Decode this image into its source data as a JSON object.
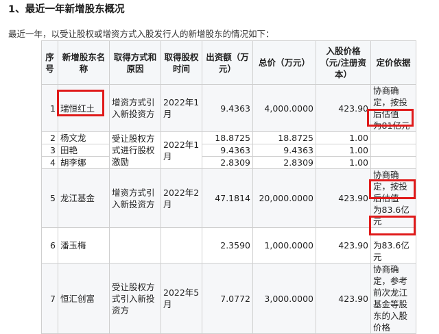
{
  "heading": "1、最近一年新增股东概况",
  "intro": "最近一年，以受让股权或增资方式入股发行人的新增股东的情况如下：",
  "table": {
    "headers": {
      "seq": "序号",
      "name": "新增股东名称",
      "method": "取得方式和原因",
      "time": "取得股权时间",
      "amount": "出资额（万元）",
      "total": "总价（万元）",
      "price": "入股价格（元/注册资本）",
      "basis": "定价依据"
    },
    "rows": [
      {
        "seq": "1",
        "name": "瑞恒红土",
        "method": "增资方式引入新投资方",
        "time": "2022年1月",
        "amount": "9.4363",
        "total": "4,000.0000",
        "price": "423.90",
        "basis_a": "协商确定，按投后估值",
        "basis_b": "为81亿元"
      },
      {
        "seq": "2",
        "name": "杨文龙",
        "amount": "18.8725",
        "total": "18.8725",
        "price": "1.00"
      },
      {
        "seq": "3",
        "name": "田艳",
        "amount": "9.4363",
        "total": "9.4363",
        "price": "1.00"
      },
      {
        "seq": "4",
        "name": "胡李娜",
        "amount": "2.8309",
        "total": "2.8309",
        "price": "1.00"
      },
      {
        "seq": "5",
        "name": "龙江基金",
        "method": "增资方式引入新投资方",
        "time": "2022年2月",
        "amount": "47.1814",
        "total": "20,000.0000",
        "price": "423.90",
        "basis_a": "协商确定，按投后估值",
        "basis_b": "为83.6亿元"
      },
      {
        "seq": "6",
        "name": "潘玉梅",
        "amount": "2.3590",
        "total": "1,000.0000",
        "price": "423.90",
        "basis_b": "为83.6亿元"
      },
      {
        "seq": "7",
        "name": "恒汇创富",
        "method": "受让股权方式引入新投资方",
        "time": "2022年5月",
        "amount": "7.0772",
        "total": "3,000.0000",
        "price": "423.90",
        "basis_a": "协商确定，参考前次龙江基金等股东的入股价格"
      }
    ],
    "group_2_4": {
      "method": "受让股权方式进行股权激励",
      "time": "2022年1月"
    }
  }
}
